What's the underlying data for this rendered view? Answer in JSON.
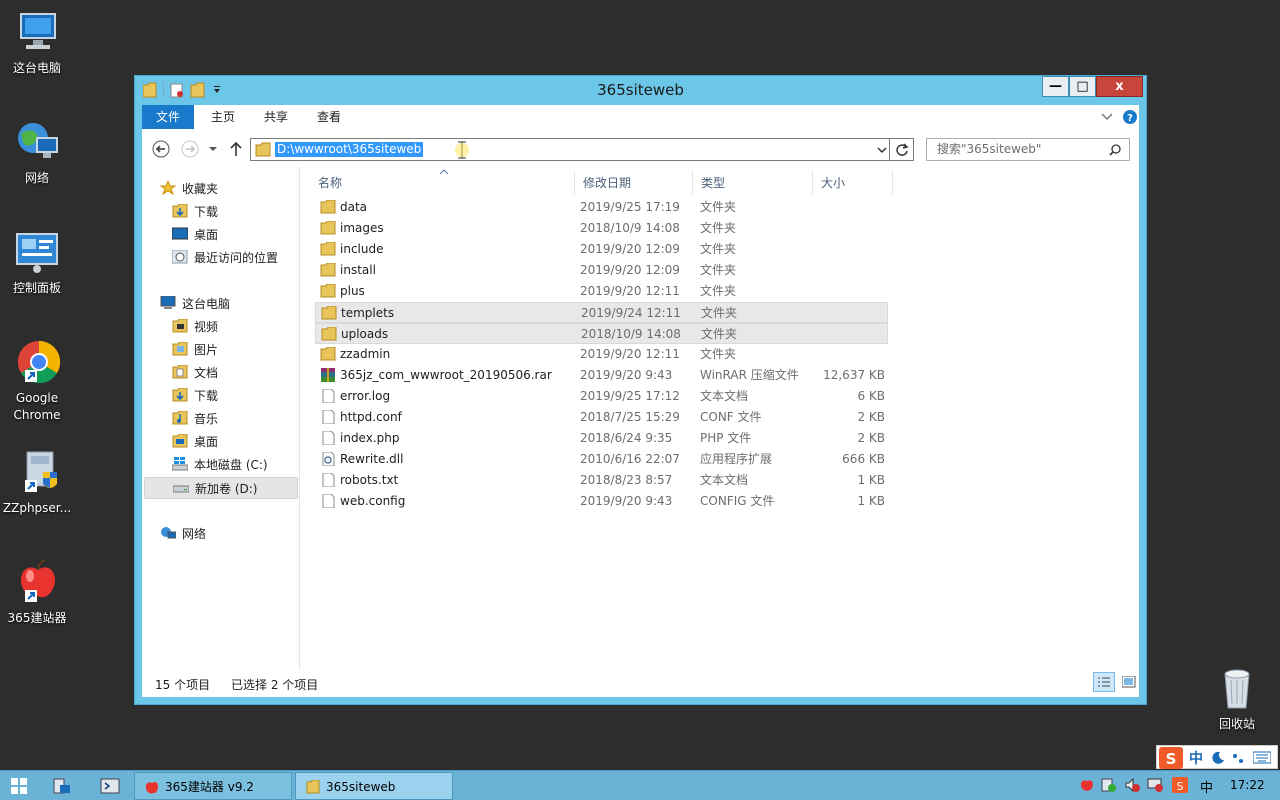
{
  "desktop": {
    "icons": [
      {
        "label": "这台电脑",
        "icon": "computer-icon"
      },
      {
        "label": "网络",
        "icon": "network-globe-icon"
      },
      {
        "label": "控制面板",
        "icon": "control-panel-icon"
      },
      {
        "label": "Google Chrome",
        "icon": "chrome-icon"
      },
      {
        "label": "ZZphpser...",
        "icon": "installer-shield-icon"
      },
      {
        "label": "365建站器",
        "icon": "apple-icon"
      },
      {
        "label": "回收站",
        "icon": "recycle-bin-icon"
      }
    ]
  },
  "window": {
    "title": "365siteweb",
    "minimize": "—",
    "maximize": "□",
    "close": "x"
  },
  "ribbon": {
    "tabs": [
      "文件",
      "主页",
      "共享",
      "查看"
    ]
  },
  "address": {
    "path": "D:\\wwwroot\\365siteweb",
    "search_placeholder": "搜索\"365siteweb\""
  },
  "nav": {
    "favorites_label": "收藏夹",
    "favorites": [
      "下载",
      "桌面",
      "最近访问的位置"
    ],
    "pc_label": "这台电脑",
    "pc_items": [
      "视频",
      "图片",
      "文档",
      "下载",
      "音乐",
      "桌面",
      "本地磁盘 (C:)",
      "新加卷 (D:)"
    ],
    "network_label": "网络"
  },
  "columns": [
    "名称",
    "修改日期",
    "类型",
    "大小"
  ],
  "files": [
    {
      "name": "data",
      "date": "2019/9/25 17:19",
      "type": "文件夹",
      "size": "",
      "kind": "folder"
    },
    {
      "name": "images",
      "date": "2018/10/9 14:08",
      "type": "文件夹",
      "size": "",
      "kind": "folder"
    },
    {
      "name": "include",
      "date": "2019/9/20 12:09",
      "type": "文件夹",
      "size": "",
      "kind": "folder"
    },
    {
      "name": "install",
      "date": "2019/9/20 12:09",
      "type": "文件夹",
      "size": "",
      "kind": "folder"
    },
    {
      "name": "plus",
      "date": "2019/9/20 12:11",
      "type": "文件夹",
      "size": "",
      "kind": "folder"
    },
    {
      "name": "templets",
      "date": "2019/9/24 12:11",
      "type": "文件夹",
      "size": "",
      "kind": "folder",
      "selected": true
    },
    {
      "name": "uploads",
      "date": "2018/10/9 14:08",
      "type": "文件夹",
      "size": "",
      "kind": "folder",
      "selected": true
    },
    {
      "name": "zzadmin",
      "date": "2019/9/20 12:11",
      "type": "文件夹",
      "size": "",
      "kind": "folder"
    },
    {
      "name": "365jz_com_wwwroot_20190506.rar",
      "date": "2019/9/20 9:43",
      "type": "WinRAR 压缩文件",
      "size": "12,637 KB",
      "kind": "rar"
    },
    {
      "name": "error.log",
      "date": "2019/9/25 17:12",
      "type": "文本文档",
      "size": "6 KB",
      "kind": "file"
    },
    {
      "name": "httpd.conf",
      "date": "2018/7/25 15:29",
      "type": "CONF 文件",
      "size": "2 KB",
      "kind": "file"
    },
    {
      "name": "index.php",
      "date": "2018/6/24 9:35",
      "type": "PHP 文件",
      "size": "2 KB",
      "kind": "file"
    },
    {
      "name": "Rewrite.dll",
      "date": "2010/6/16 22:07",
      "type": "应用程序扩展",
      "size": "666 KB",
      "kind": "dll"
    },
    {
      "name": "robots.txt",
      "date": "2018/8/23 8:57",
      "type": "文本文档",
      "size": "1 KB",
      "kind": "file"
    },
    {
      "name": "web.config",
      "date": "2019/9/20 9:43",
      "type": "CONFIG 文件",
      "size": "1 KB",
      "kind": "file"
    }
  ],
  "status": {
    "count": "15 个项目",
    "selected": "已选择 2 个项目"
  },
  "taskbar": {
    "apps": [
      "365建站器 v9.2",
      "365siteweb"
    ],
    "ime": "中",
    "clock": "17:22"
  }
}
